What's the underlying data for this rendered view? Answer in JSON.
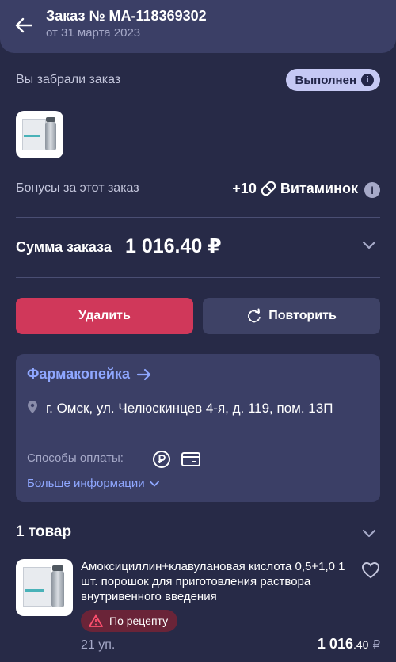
{
  "header": {
    "title": "Заказ № МА-118369302",
    "date": "от 31 марта 2023",
    "back_icon": "arrow-left-icon"
  },
  "status": {
    "label": "Вы забрали заказ",
    "badge": "Выполнен"
  },
  "bonus": {
    "label": "Бонусы за этот заказ",
    "amount": "+10",
    "unit": "Витаминок"
  },
  "sum": {
    "label": "Сумма заказа",
    "value": "1 016.40 ₽"
  },
  "actions": {
    "delete_label": "Удалить",
    "repeat_label": "Повторить"
  },
  "store": {
    "name": "Фармакопейка",
    "address": "г. Омск, ул. Челюскинцев 4-я, д. 119, пом. 13П",
    "payment_label": "Способы оплаты:",
    "more_info": "Больше информации"
  },
  "items": {
    "title": "1 товар",
    "list": [
      {
        "name": "Амоксициллин+клавулановая кислота 0,5+1,0 1 шт. порошок для приготовления раствора внутривенного введения",
        "badge": "По рецепту",
        "qty": "21 уп.",
        "price_main": "1 016",
        "price_cents": ".40",
        "currency": "₽"
      }
    ]
  },
  "colors": {
    "background": "#272a47",
    "header": "#3b3f66",
    "accent_link": "#8fa7ff",
    "delete_button": "#d0385a",
    "badge": "#c5c8f4"
  }
}
